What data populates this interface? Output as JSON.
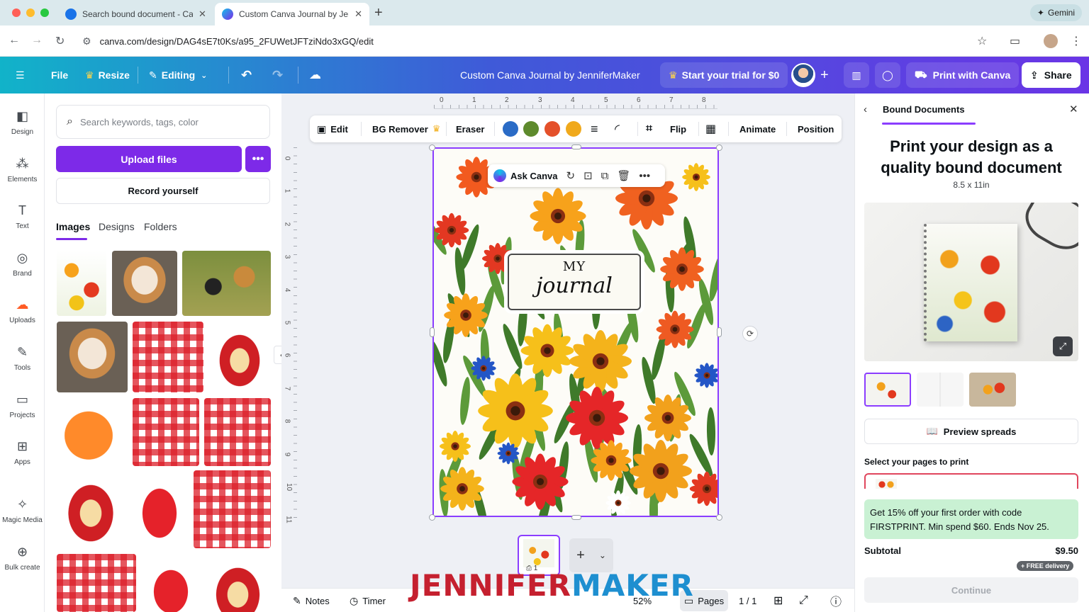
{
  "browser": {
    "tabs": [
      {
        "title": "Search bound document - Ca"
      },
      {
        "title": "Custom Canva Journal by Jen"
      }
    ],
    "url": "canva.com/design/DAG4sE7t0Ks/a95_2FUWetJFTziNdo3xGQ/edit",
    "gemini_label": "Gemini"
  },
  "header": {
    "file": "File",
    "resize": "Resize",
    "editing": "Editing",
    "doc_title": "Custom Canva Journal by JenniferMaker",
    "trial": "Start your trial for $0",
    "print": "Print with Canva",
    "share": "Share"
  },
  "rail": [
    {
      "label": "Design",
      "icon": "design-icon"
    },
    {
      "label": "Elements",
      "icon": "elements-icon"
    },
    {
      "label": "Text",
      "icon": "text-icon"
    },
    {
      "label": "Brand",
      "icon": "brand-icon"
    },
    {
      "label": "Uploads",
      "icon": "uploads-icon"
    },
    {
      "label": "Tools",
      "icon": "tools-icon"
    },
    {
      "label": "Projects",
      "icon": "projects-icon"
    },
    {
      "label": "Apps",
      "icon": "apps-icon"
    },
    {
      "label": "Magic Media",
      "icon": "magic-media-icon"
    },
    {
      "label": "Bulk create",
      "icon": "bulk-create-icon"
    }
  ],
  "panel": {
    "search_placeholder": "Search keywords, tags, color",
    "upload": "Upload files",
    "record": "Record yourself",
    "tabs": [
      "Images",
      "Designs",
      "Folders"
    ]
  },
  "toolbar": {
    "edit": "Edit",
    "bg_remover": "BG Remover",
    "eraser": "Eraser",
    "flip": "Flip",
    "animate": "Animate",
    "position": "Position",
    "colors": [
      "#2a6bc6",
      "#5e8a2c",
      "#e4502a",
      "#f0a91c"
    ]
  },
  "ruler": {
    "top": [
      "0",
      "1",
      "2",
      "3",
      "4",
      "5",
      "6",
      "7",
      "8"
    ],
    "left": [
      "0",
      "1",
      "2",
      "3",
      "4",
      "5",
      "6",
      "7",
      "8",
      "9",
      "10",
      "11"
    ]
  },
  "canvas": {
    "ask_canva": "Ask Canva",
    "title_my": "MY",
    "title_journal": "journal"
  },
  "bottom": {
    "notes": "Notes",
    "timer": "Timer",
    "zoom": "52%",
    "pages": "Pages",
    "page_count": "1 / 1",
    "thumb_page": "1",
    "watermark_a": "JENNIFER",
    "watermark_b": "MAKER"
  },
  "right_panel": {
    "heading": "Bound Documents",
    "title": "Print your design as a quality bound document",
    "size": "8.5 x 11in",
    "preview_spreads": "Preview spreads",
    "select_label": "Select your pages to print",
    "promo": "Get 15% off your first order with code FIRSTPRINT. Min spend $60. Ends Nov 25.",
    "subtotal_label": "Subtotal",
    "subtotal_value": "$9.50",
    "delivery": "+ FREE delivery",
    "continue": "Continue"
  }
}
